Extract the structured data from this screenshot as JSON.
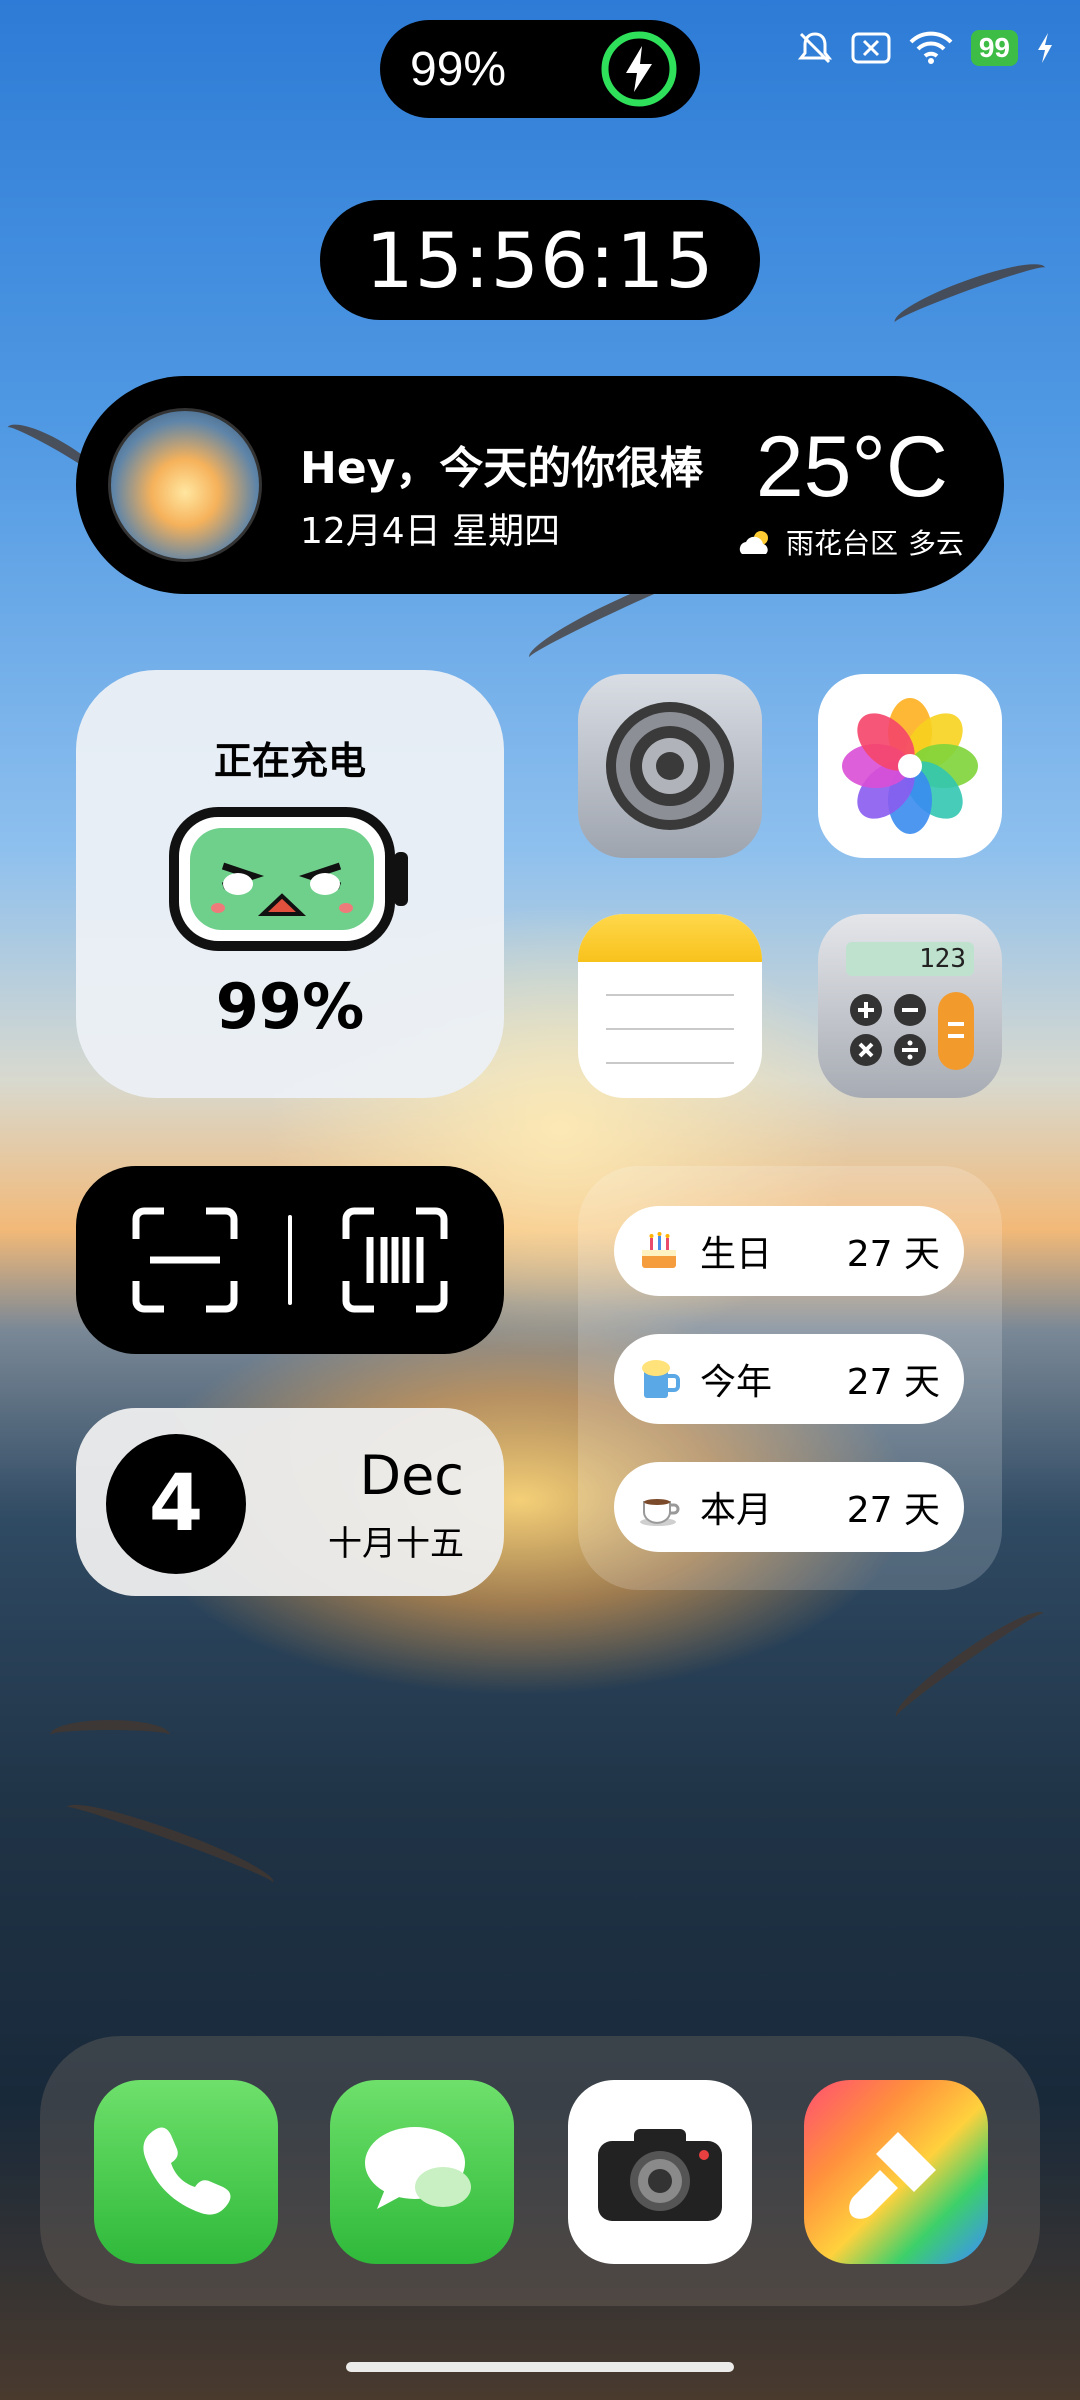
{
  "status_bar": {
    "charge_percent": "99%",
    "battery_level": "99"
  },
  "clock": {
    "time": "15:56:15"
  },
  "greeting": {
    "title": "Hey，今天的你很棒",
    "date": "12月4日 星期四",
    "temperature": "25°C",
    "location": "雨花台区",
    "condition": "多云"
  },
  "charging_widget": {
    "title": "正在充电",
    "percent": "99%"
  },
  "apps": {
    "settings": "settings-icon",
    "photos": "photos-icon",
    "notes": "notes-icon",
    "calculator": "calculator-icon",
    "calculator_display": "123"
  },
  "date_widget": {
    "day": "4",
    "month": "Dec",
    "lunar": "十月十五"
  },
  "countdown": [
    {
      "icon": "cake-icon",
      "label": "生日",
      "value": "27 天"
    },
    {
      "icon": "beer-icon",
      "label": "今年",
      "value": "27 天"
    },
    {
      "icon": "coffee-icon",
      "label": "本月",
      "value": "27 天"
    }
  ],
  "dock": [
    "phone-icon",
    "messages-icon",
    "camera-icon",
    "paint-brush-icon"
  ]
}
